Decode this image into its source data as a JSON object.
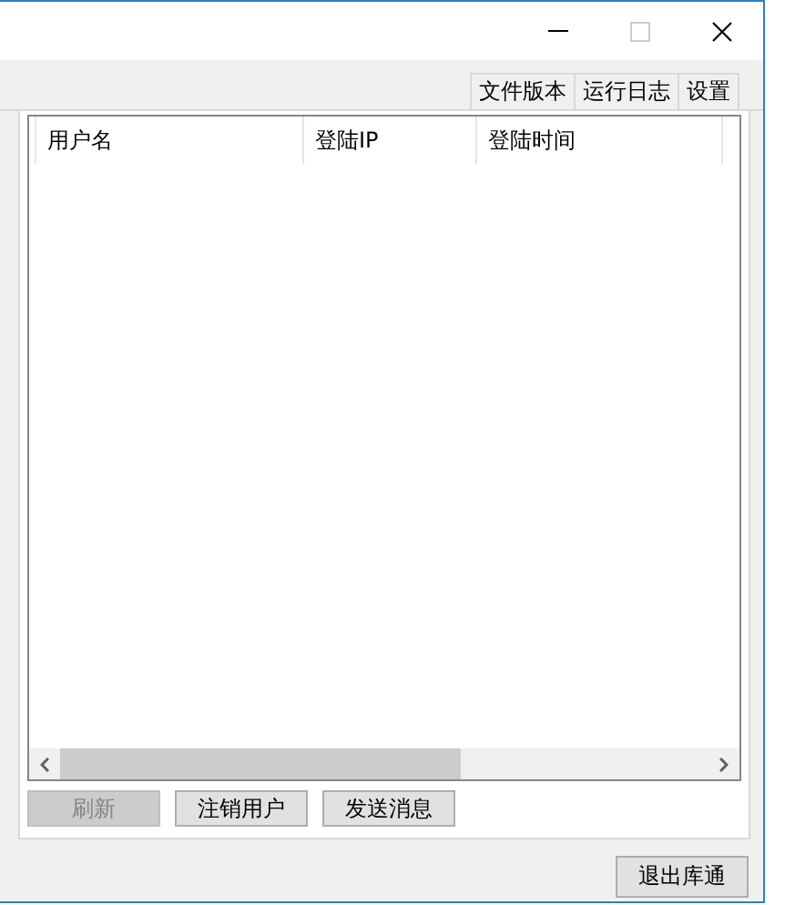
{
  "window": {
    "controls": [
      {
        "kind": "minimize"
      },
      {
        "kind": "maximize"
      },
      {
        "kind": "close"
      }
    ]
  },
  "tabs": [
    {
      "label": "文件版本",
      "selected": false
    },
    {
      "label": "运行日志",
      "selected": false
    },
    {
      "label": "设置",
      "selected": false
    }
  ],
  "table": {
    "columns": [
      "用户名",
      "登陆IP",
      "登陆时间"
    ]
  },
  "buttons": [
    {
      "label": "刷新",
      "disabled": true
    },
    {
      "label": "注销用户",
      "disabled": false
    },
    {
      "label": "发送消息",
      "disabled": false
    }
  ],
  "footer_button": {
    "label": "退出库通",
    "disabled": false
  }
}
